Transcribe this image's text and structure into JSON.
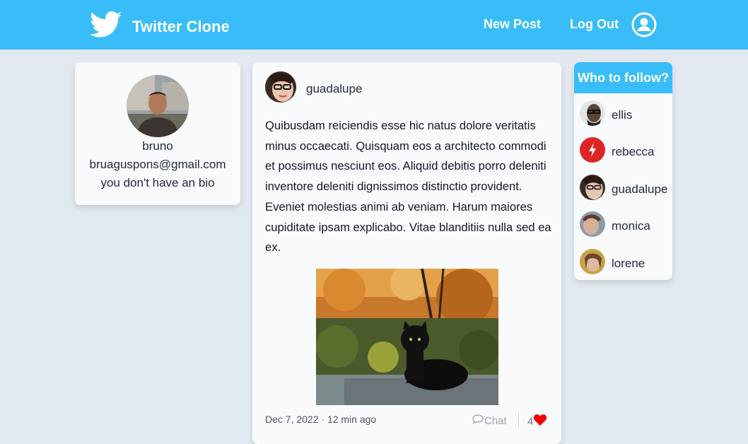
{
  "navbar": {
    "brand_title": "Twitter Clone",
    "new_post_label": "New Post",
    "logout_label": "Log Out",
    "brand_color": "#38bdf8",
    "logo_icon": "twitter-bird-icon",
    "user_icon": "user-circle-icon"
  },
  "profile": {
    "username": "bruno",
    "email": "bruaguspons@gmail.com",
    "bio": "you don't have an bio"
  },
  "post": {
    "username": "guadalupe",
    "body": "Quibusdam reiciendis esse hic natus dolore veritatis minus occaecati. Quisquam eos a architecto commodi et possimus nesciunt eos. Aliquid debitis porro deleniti inventore deleniti dignissimos distinctio provident. Eveniet molestias animi ab veniam. Harum maiores cupiditate ipsam explicabo. Vitae blanditiis nulla sed ea ex.",
    "image_subject": "black cat sitting on a stone ledge in autumn",
    "date": "Dec 7, 2022 · 12 min ago",
    "chat_label": "Chat",
    "likes": "4",
    "like_color": "#ef0000"
  },
  "who_to_follow": {
    "title": "Who to follow?",
    "users": [
      {
        "name": "ellis"
      },
      {
        "name": "rebecca"
      },
      {
        "name": "guadalupe"
      },
      {
        "name": "monica"
      },
      {
        "name": "lorene"
      }
    ]
  }
}
